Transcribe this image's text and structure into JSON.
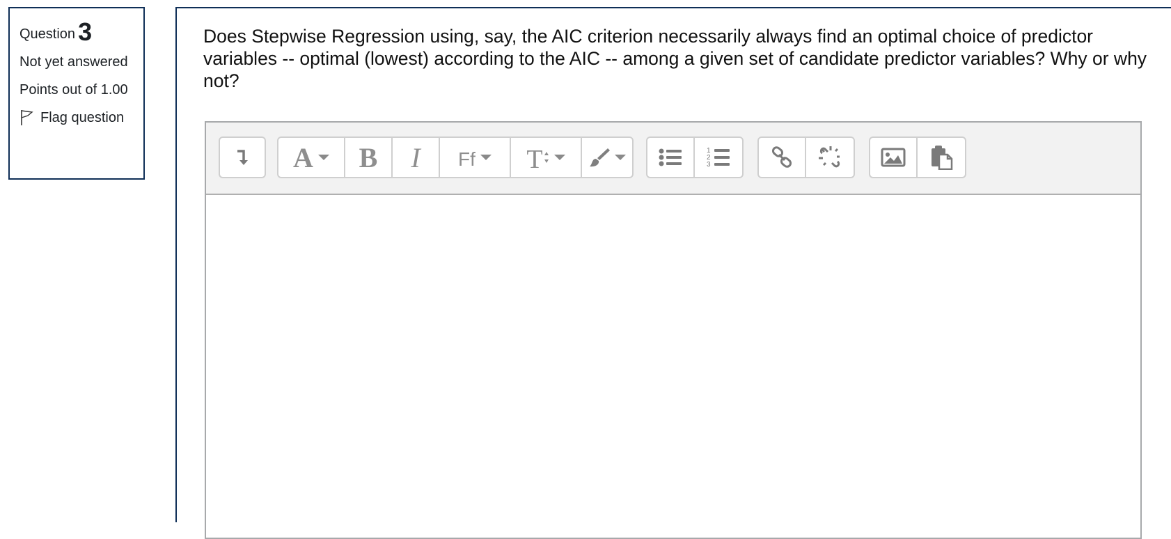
{
  "info": {
    "question_label": "Question",
    "question_number": "3",
    "state": "Not yet answered",
    "grade": "Points out of 1.00",
    "flag_label": "Flag question"
  },
  "question": {
    "text": "Does Stepwise Regression using, say, the AIC criterion necessarily always find an optimal choice of predictor variables -- optimal (lowest) according to the AIC -- among a given set of candidate predictor variables? Why or why not?"
  },
  "editor": {
    "toolbar": {
      "font_color_glyph": "A",
      "bold_glyph": "B",
      "italic_glyph": "I",
      "font_family_glyph": "Ff",
      "font_size_glyph": "T"
    },
    "answer_value": ""
  },
  "colors": {
    "border": "#0f2f57",
    "toolbar_bg": "#f2f2f2",
    "icon": "#8a8a8a"
  }
}
